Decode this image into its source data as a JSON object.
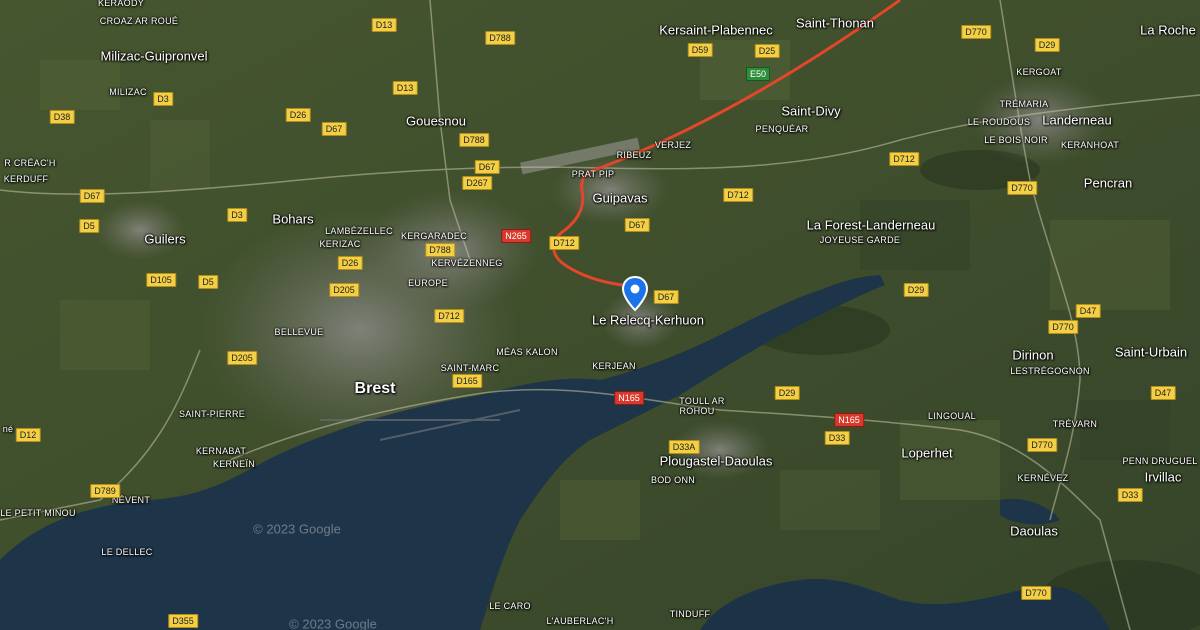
{
  "map": {
    "style": "satellite",
    "colors": {
      "water": "#1e3448",
      "land": "#41502f",
      "route": "#e2462b",
      "marker": "#1a73e8",
      "shield": "#f3cf45"
    },
    "route": {
      "description": "highlighted route from Le Relecq-Kerhuon north-east along N12 toward Saint-Thonan"
    },
    "marker": {
      "name": "Le Relecq-Kerhuon",
      "icon": "location-pin-icon"
    },
    "watermarks": [
      "© 2023 Google",
      "© 2023 Google"
    ],
    "places": [
      {
        "name": "Brest",
        "kind": "city"
      },
      {
        "name": "Guipavas",
        "kind": "town"
      },
      {
        "name": "Le Relecq-Kerhuon",
        "kind": "town"
      },
      {
        "name": "Gouesnou",
        "kind": "town"
      },
      {
        "name": "Bohars",
        "kind": "town"
      },
      {
        "name": "Guilers",
        "kind": "town"
      },
      {
        "name": "Milizac-Guipronvel",
        "kind": "town"
      },
      {
        "name": "Kersaint-Plabennec",
        "kind": "town"
      },
      {
        "name": "Saint-Thonan",
        "kind": "town"
      },
      {
        "name": "Saint-Divy",
        "kind": "town"
      },
      {
        "name": "Landerneau",
        "kind": "town"
      },
      {
        "name": "La Roche",
        "kind": "town"
      },
      {
        "name": "Pencran",
        "kind": "town"
      },
      {
        "name": "La Forest-Landerneau",
        "kind": "town"
      },
      {
        "name": "Dirinon",
        "kind": "town"
      },
      {
        "name": "Saint-Urbain",
        "kind": "town"
      },
      {
        "name": "Loperhet",
        "kind": "town"
      },
      {
        "name": "Plougastel-Daoulas",
        "kind": "town"
      },
      {
        "name": "Daoulas",
        "kind": "town"
      },
      {
        "name": "Irvillac",
        "kind": "town"
      },
      {
        "name": "KERAODY",
        "kind": "locality"
      },
      {
        "name": "CROAZ AR ROUÉ",
        "kind": "locality"
      },
      {
        "name": "MILIZAC",
        "kind": "locality"
      },
      {
        "name": "R CRÉAC'H",
        "kind": "locality"
      },
      {
        "name": "KERDUFF",
        "kind": "locality"
      },
      {
        "name": "LAMBÉZELLEC",
        "kind": "locality"
      },
      {
        "name": "KERIZAC",
        "kind": "locality"
      },
      {
        "name": "KERGARADEC",
        "kind": "locality"
      },
      {
        "name": "KERVÉZENNEG",
        "kind": "locality"
      },
      {
        "name": "EUROPE",
        "kind": "locality"
      },
      {
        "name": "BELLEVUE",
        "kind": "locality"
      },
      {
        "name": "SAINT-PIERRE",
        "kind": "locality"
      },
      {
        "name": "KERNABAT",
        "kind": "locality"
      },
      {
        "name": "KERNEÏN",
        "kind": "locality"
      },
      {
        "name": "NÉVENT",
        "kind": "locality"
      },
      {
        "name": "LE PETIT MINOU",
        "kind": "locality"
      },
      {
        "name": "LE DELLEC",
        "kind": "locality"
      },
      {
        "name": "SAINT-MARC",
        "kind": "locality"
      },
      {
        "name": "MÉAS KALON",
        "kind": "locality"
      },
      {
        "name": "KERJEAN",
        "kind": "locality"
      },
      {
        "name": "PRAT PIP",
        "kind": "locality"
      },
      {
        "name": "RIBEUZ",
        "kind": "locality"
      },
      {
        "name": "VERJEZ",
        "kind": "locality"
      },
      {
        "name": "PENQUÉAR",
        "kind": "locality"
      },
      {
        "name": "JOYEUSE GARDE",
        "kind": "locality"
      },
      {
        "name": "KERGOAT",
        "kind": "locality"
      },
      {
        "name": "TRÉMARIA",
        "kind": "locality"
      },
      {
        "name": "LE ROUDOUS",
        "kind": "locality"
      },
      {
        "name": "LE BOIS NOIR",
        "kind": "locality"
      },
      {
        "name": "KERANHOAT",
        "kind": "locality"
      },
      {
        "name": "TOULL AR",
        "kind": "locality"
      },
      {
        "name": "ROHOU",
        "kind": "locality"
      },
      {
        "name": "BOD ONN",
        "kind": "locality"
      },
      {
        "name": "LINGOUAL",
        "kind": "locality"
      },
      {
        "name": "LESTRÉGOGNON",
        "kind": "locality"
      },
      {
        "name": "TRÉVARN",
        "kind": "locality"
      },
      {
        "name": "PENN DRUGUEL",
        "kind": "locality"
      },
      {
        "name": "KERNÉVEZ",
        "kind": "locality"
      },
      {
        "name": "LE CARO",
        "kind": "locality"
      },
      {
        "name": "L'AUBERLAC'H",
        "kind": "locality"
      },
      {
        "name": "TINDUFF",
        "kind": "locality"
      },
      {
        "name": "né",
        "kind": "locality"
      }
    ],
    "roads": [
      {
        "ref": "D13",
        "type": "departmental"
      },
      {
        "ref": "D13",
        "type": "departmental"
      },
      {
        "ref": "D788",
        "type": "departmental"
      },
      {
        "ref": "D788",
        "type": "departmental"
      },
      {
        "ref": "D788",
        "type": "departmental"
      },
      {
        "ref": "D3",
        "type": "departmental"
      },
      {
        "ref": "D3",
        "type": "departmental"
      },
      {
        "ref": "D38",
        "type": "departmental"
      },
      {
        "ref": "D26",
        "type": "departmental"
      },
      {
        "ref": "D26",
        "type": "departmental"
      },
      {
        "ref": "D67",
        "type": "departmental"
      },
      {
        "ref": "D67",
        "type": "departmental"
      },
      {
        "ref": "D67",
        "type": "departmental"
      },
      {
        "ref": "D67",
        "type": "departmental"
      },
      {
        "ref": "D67",
        "type": "departmental"
      },
      {
        "ref": "D267",
        "type": "departmental"
      },
      {
        "ref": "D5",
        "type": "departmental"
      },
      {
        "ref": "D5",
        "type": "departmental"
      },
      {
        "ref": "D105",
        "type": "departmental"
      },
      {
        "ref": "D205",
        "type": "departmental"
      },
      {
        "ref": "D205",
        "type": "departmental"
      },
      {
        "ref": "D712",
        "type": "departmental"
      },
      {
        "ref": "D712",
        "type": "departmental"
      },
      {
        "ref": "D712",
        "type": "departmental"
      },
      {
        "ref": "D712",
        "type": "departmental"
      },
      {
        "ref": "D165",
        "type": "departmental"
      },
      {
        "ref": "D12",
        "type": "departmental"
      },
      {
        "ref": "D789",
        "type": "departmental"
      },
      {
        "ref": "D355",
        "type": "departmental"
      },
      {
        "ref": "D59",
        "type": "departmental"
      },
      {
        "ref": "D25",
        "type": "departmental"
      },
      {
        "ref": "D770",
        "type": "departmental"
      },
      {
        "ref": "D770",
        "type": "departmental"
      },
      {
        "ref": "D770",
        "type": "departmental"
      },
      {
        "ref": "D770",
        "type": "departmental"
      },
      {
        "ref": "D770",
        "type": "departmental"
      },
      {
        "ref": "D29",
        "type": "departmental"
      },
      {
        "ref": "D29",
        "type": "departmental"
      },
      {
        "ref": "D29",
        "type": "departmental"
      },
      {
        "ref": "D47",
        "type": "departmental"
      },
      {
        "ref": "D47",
        "type": "departmental"
      },
      {
        "ref": "D33",
        "type": "departmental"
      },
      {
        "ref": "D33",
        "type": "departmental"
      },
      {
        "ref": "D33A",
        "type": "departmental"
      },
      {
        "ref": "N265",
        "type": "national"
      },
      {
        "ref": "N165",
        "type": "national"
      },
      {
        "ref": "N165",
        "type": "national"
      },
      {
        "ref": "E50",
        "type": "european"
      }
    ]
  }
}
